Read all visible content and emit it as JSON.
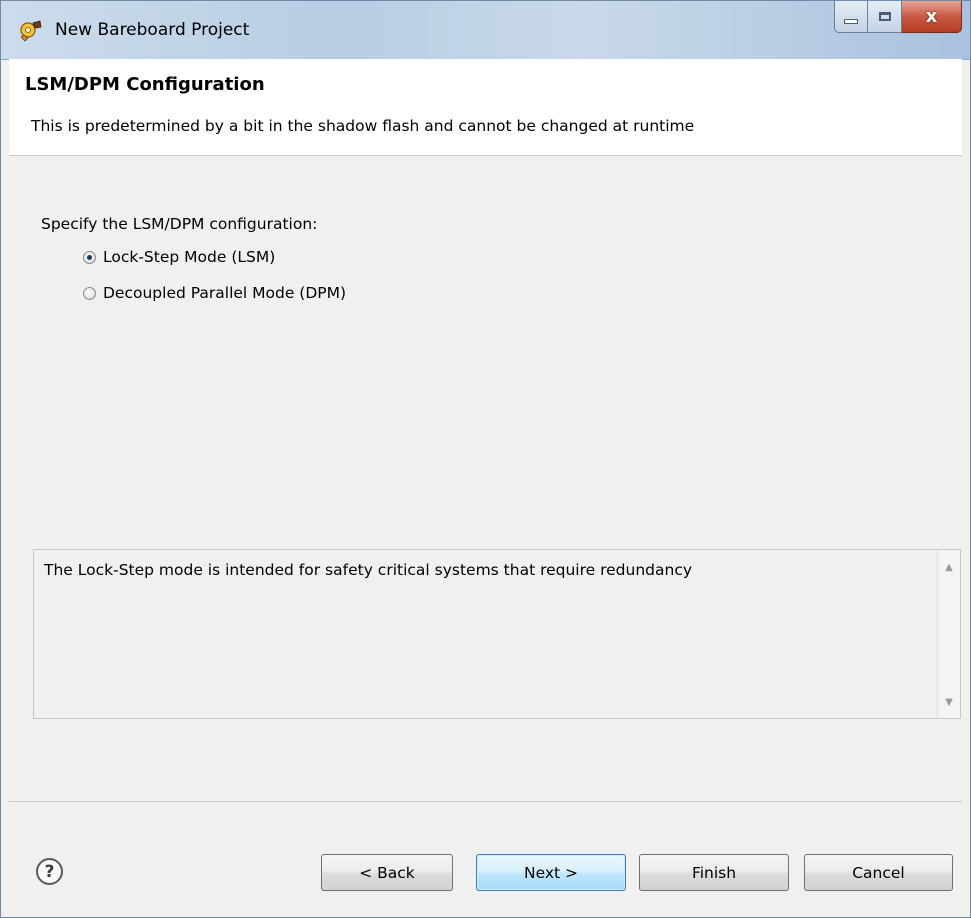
{
  "window": {
    "title": "New Bareboard Project",
    "icon": "eclipse-gear-icon",
    "controls": {
      "minimize_icon": "minimize-icon",
      "maximize_icon": "maximize-icon",
      "close_label": "x"
    }
  },
  "header": {
    "title": "LSM/DPM Configuration",
    "description": "This is predetermined by a bit in the shadow flash and cannot be changed at runtime"
  },
  "form": {
    "question": "Specify the LSM/DPM configuration:",
    "options": [
      {
        "label": "Lock-Step Mode (LSM)",
        "selected": true
      },
      {
        "label": "Decoupled Parallel Mode (DPM)",
        "selected": false
      }
    ]
  },
  "description_box": {
    "text": "The Lock-Step mode is intended for safety critical systems that require redundancy",
    "scroll_up": "▲",
    "scroll_down": "▼"
  },
  "footer": {
    "help_label": "?",
    "back_label": "< Back",
    "next_label": "Next >",
    "finish_label": "Finish",
    "cancel_label": "Cancel"
  },
  "colors": {
    "titlebar": "#b7cde4",
    "close_button": "#c75a44",
    "primary_button_border": "#3c7fb1"
  }
}
